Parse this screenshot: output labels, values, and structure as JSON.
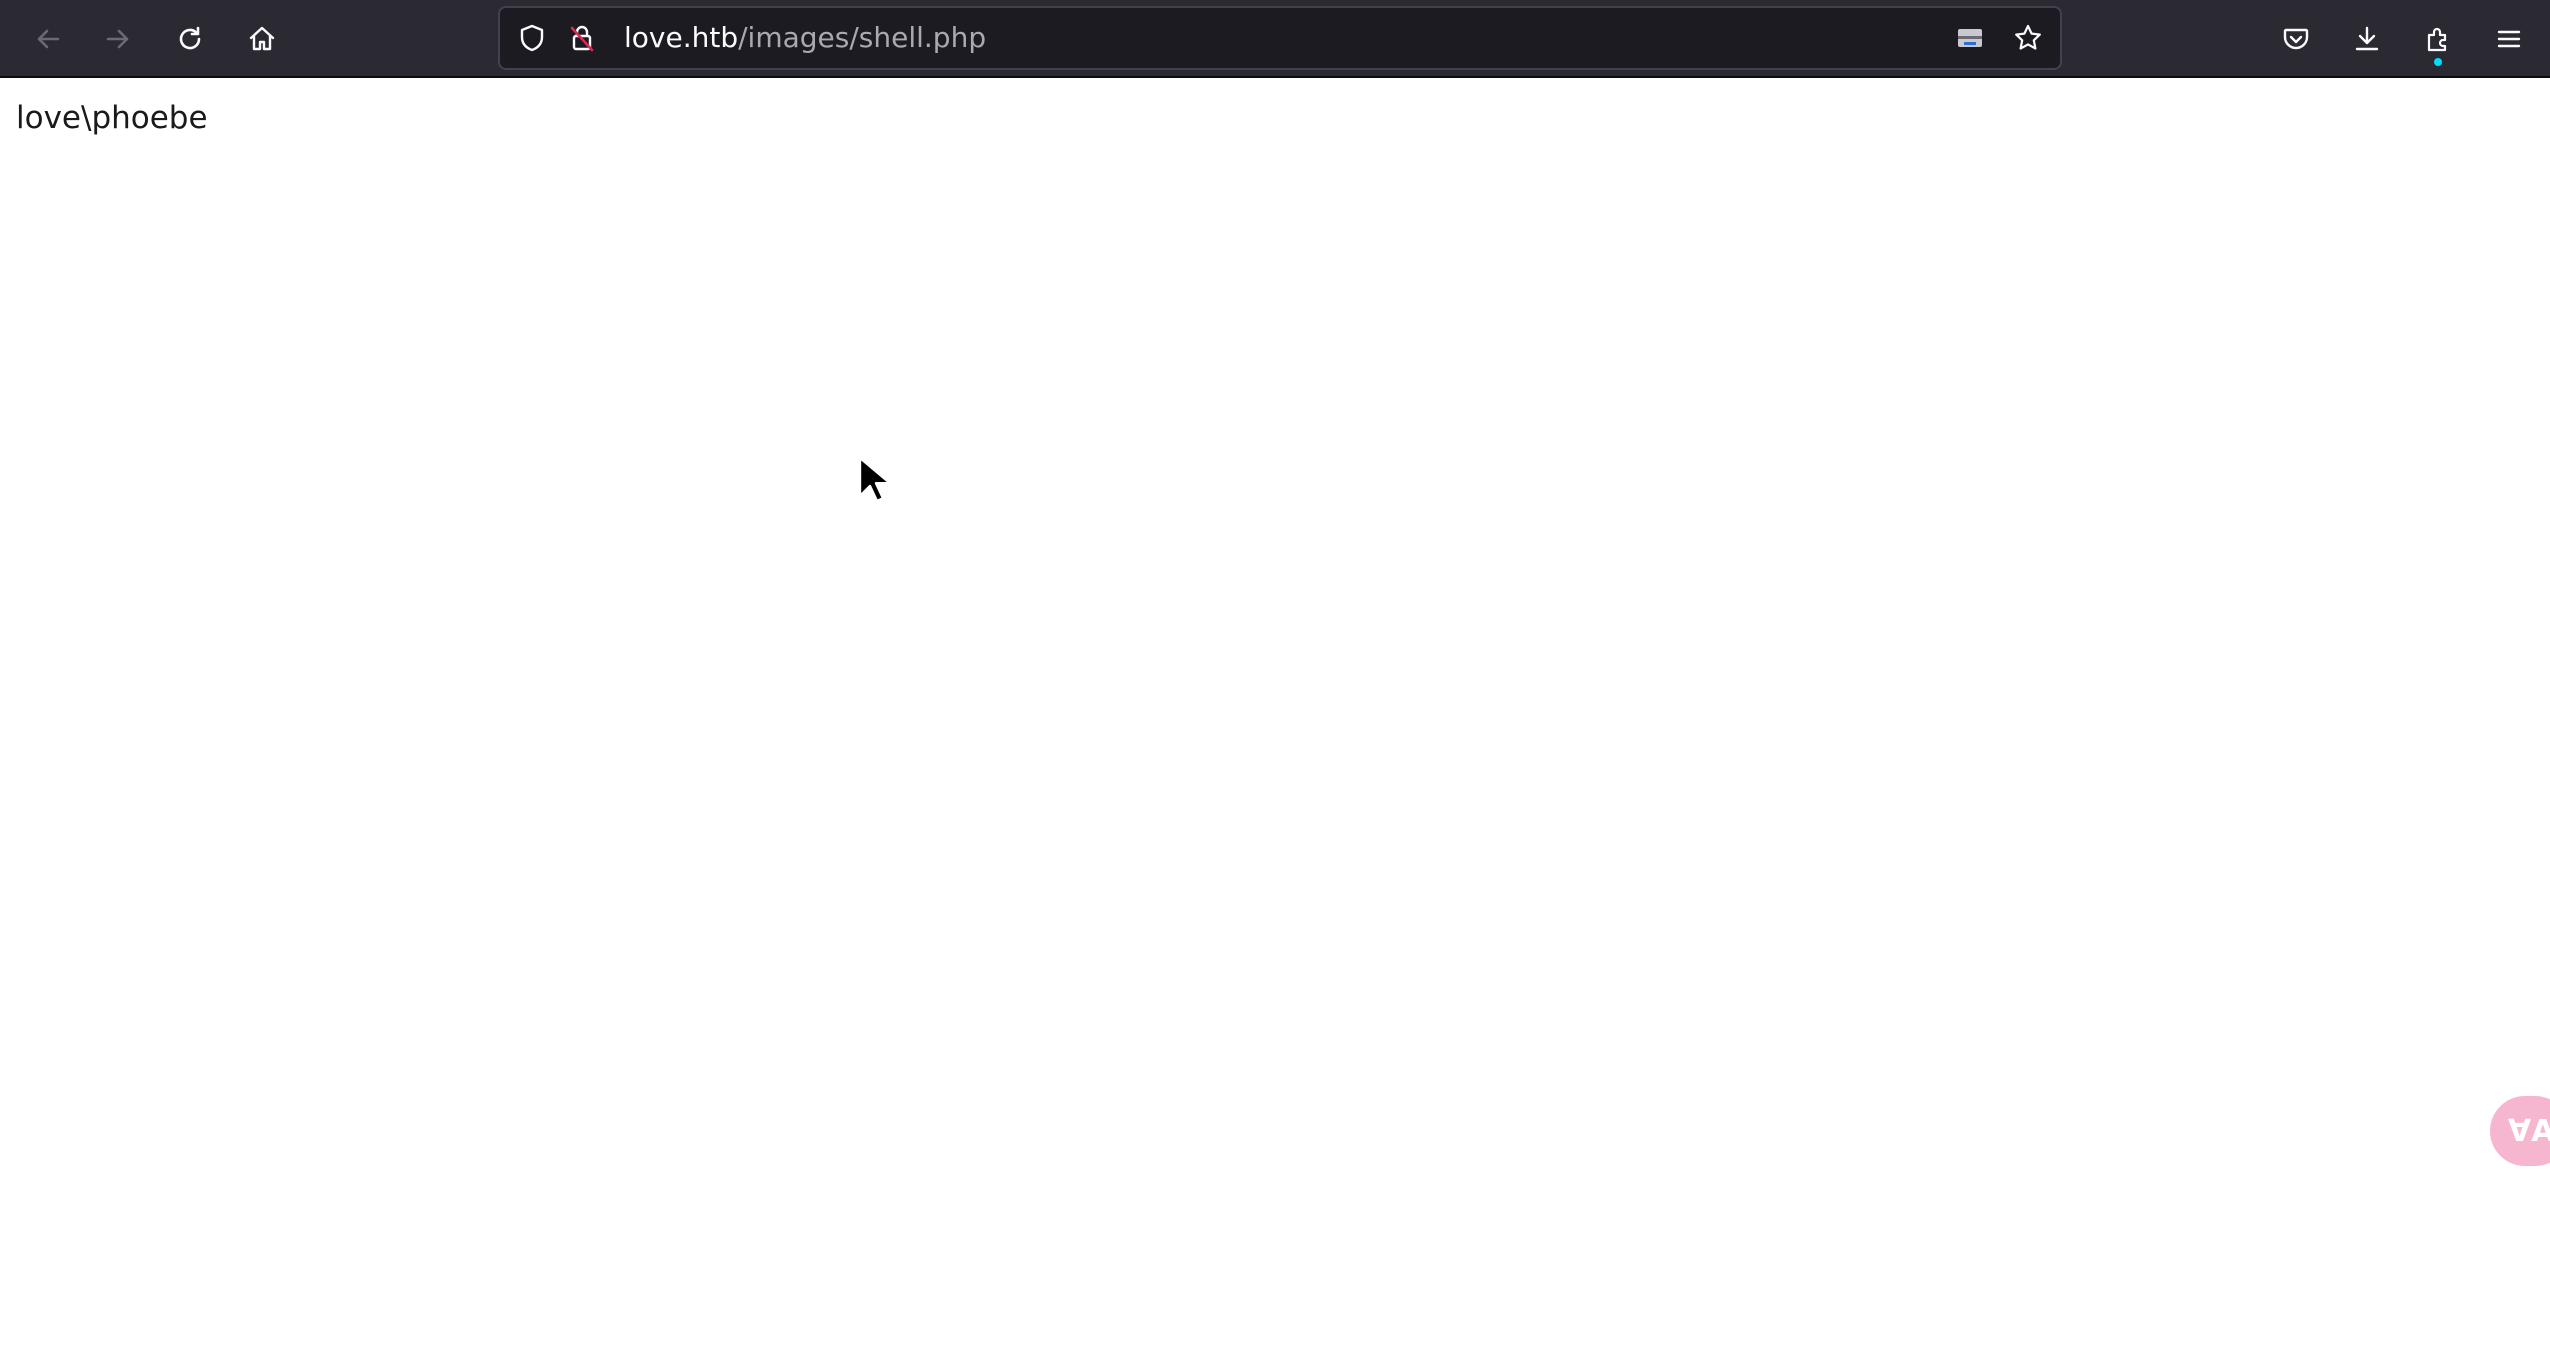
{
  "browser": {
    "url_host": "love.htb",
    "url_path": "/images/shell.php",
    "icons": {
      "back": "arrow-left-icon",
      "forward": "arrow-right-icon",
      "reload": "reload-icon",
      "home": "home-icon",
      "tracking_protection": "shield-icon",
      "connection_insecure": "lock-insecure-icon",
      "reader_view": "reader-view-icon",
      "bookmark": "star-icon",
      "pocket": "pocket-icon",
      "downloads": "download-icon",
      "extensions": "puzzle-icon",
      "menu": "hamburger-menu-icon"
    },
    "colors": {
      "toolbar_bg": "#2b2a33",
      "urlbar_bg": "#1c1b22",
      "url_text": "#fbfbfe",
      "url_path": "#a9a9b3",
      "insecure_accent": "#e22850"
    }
  },
  "page": {
    "output_text": "love\\phoebe"
  },
  "translate_widget": {
    "icon": "translate-icon",
    "label": "ⱯA",
    "color": "#f6b6cf"
  }
}
